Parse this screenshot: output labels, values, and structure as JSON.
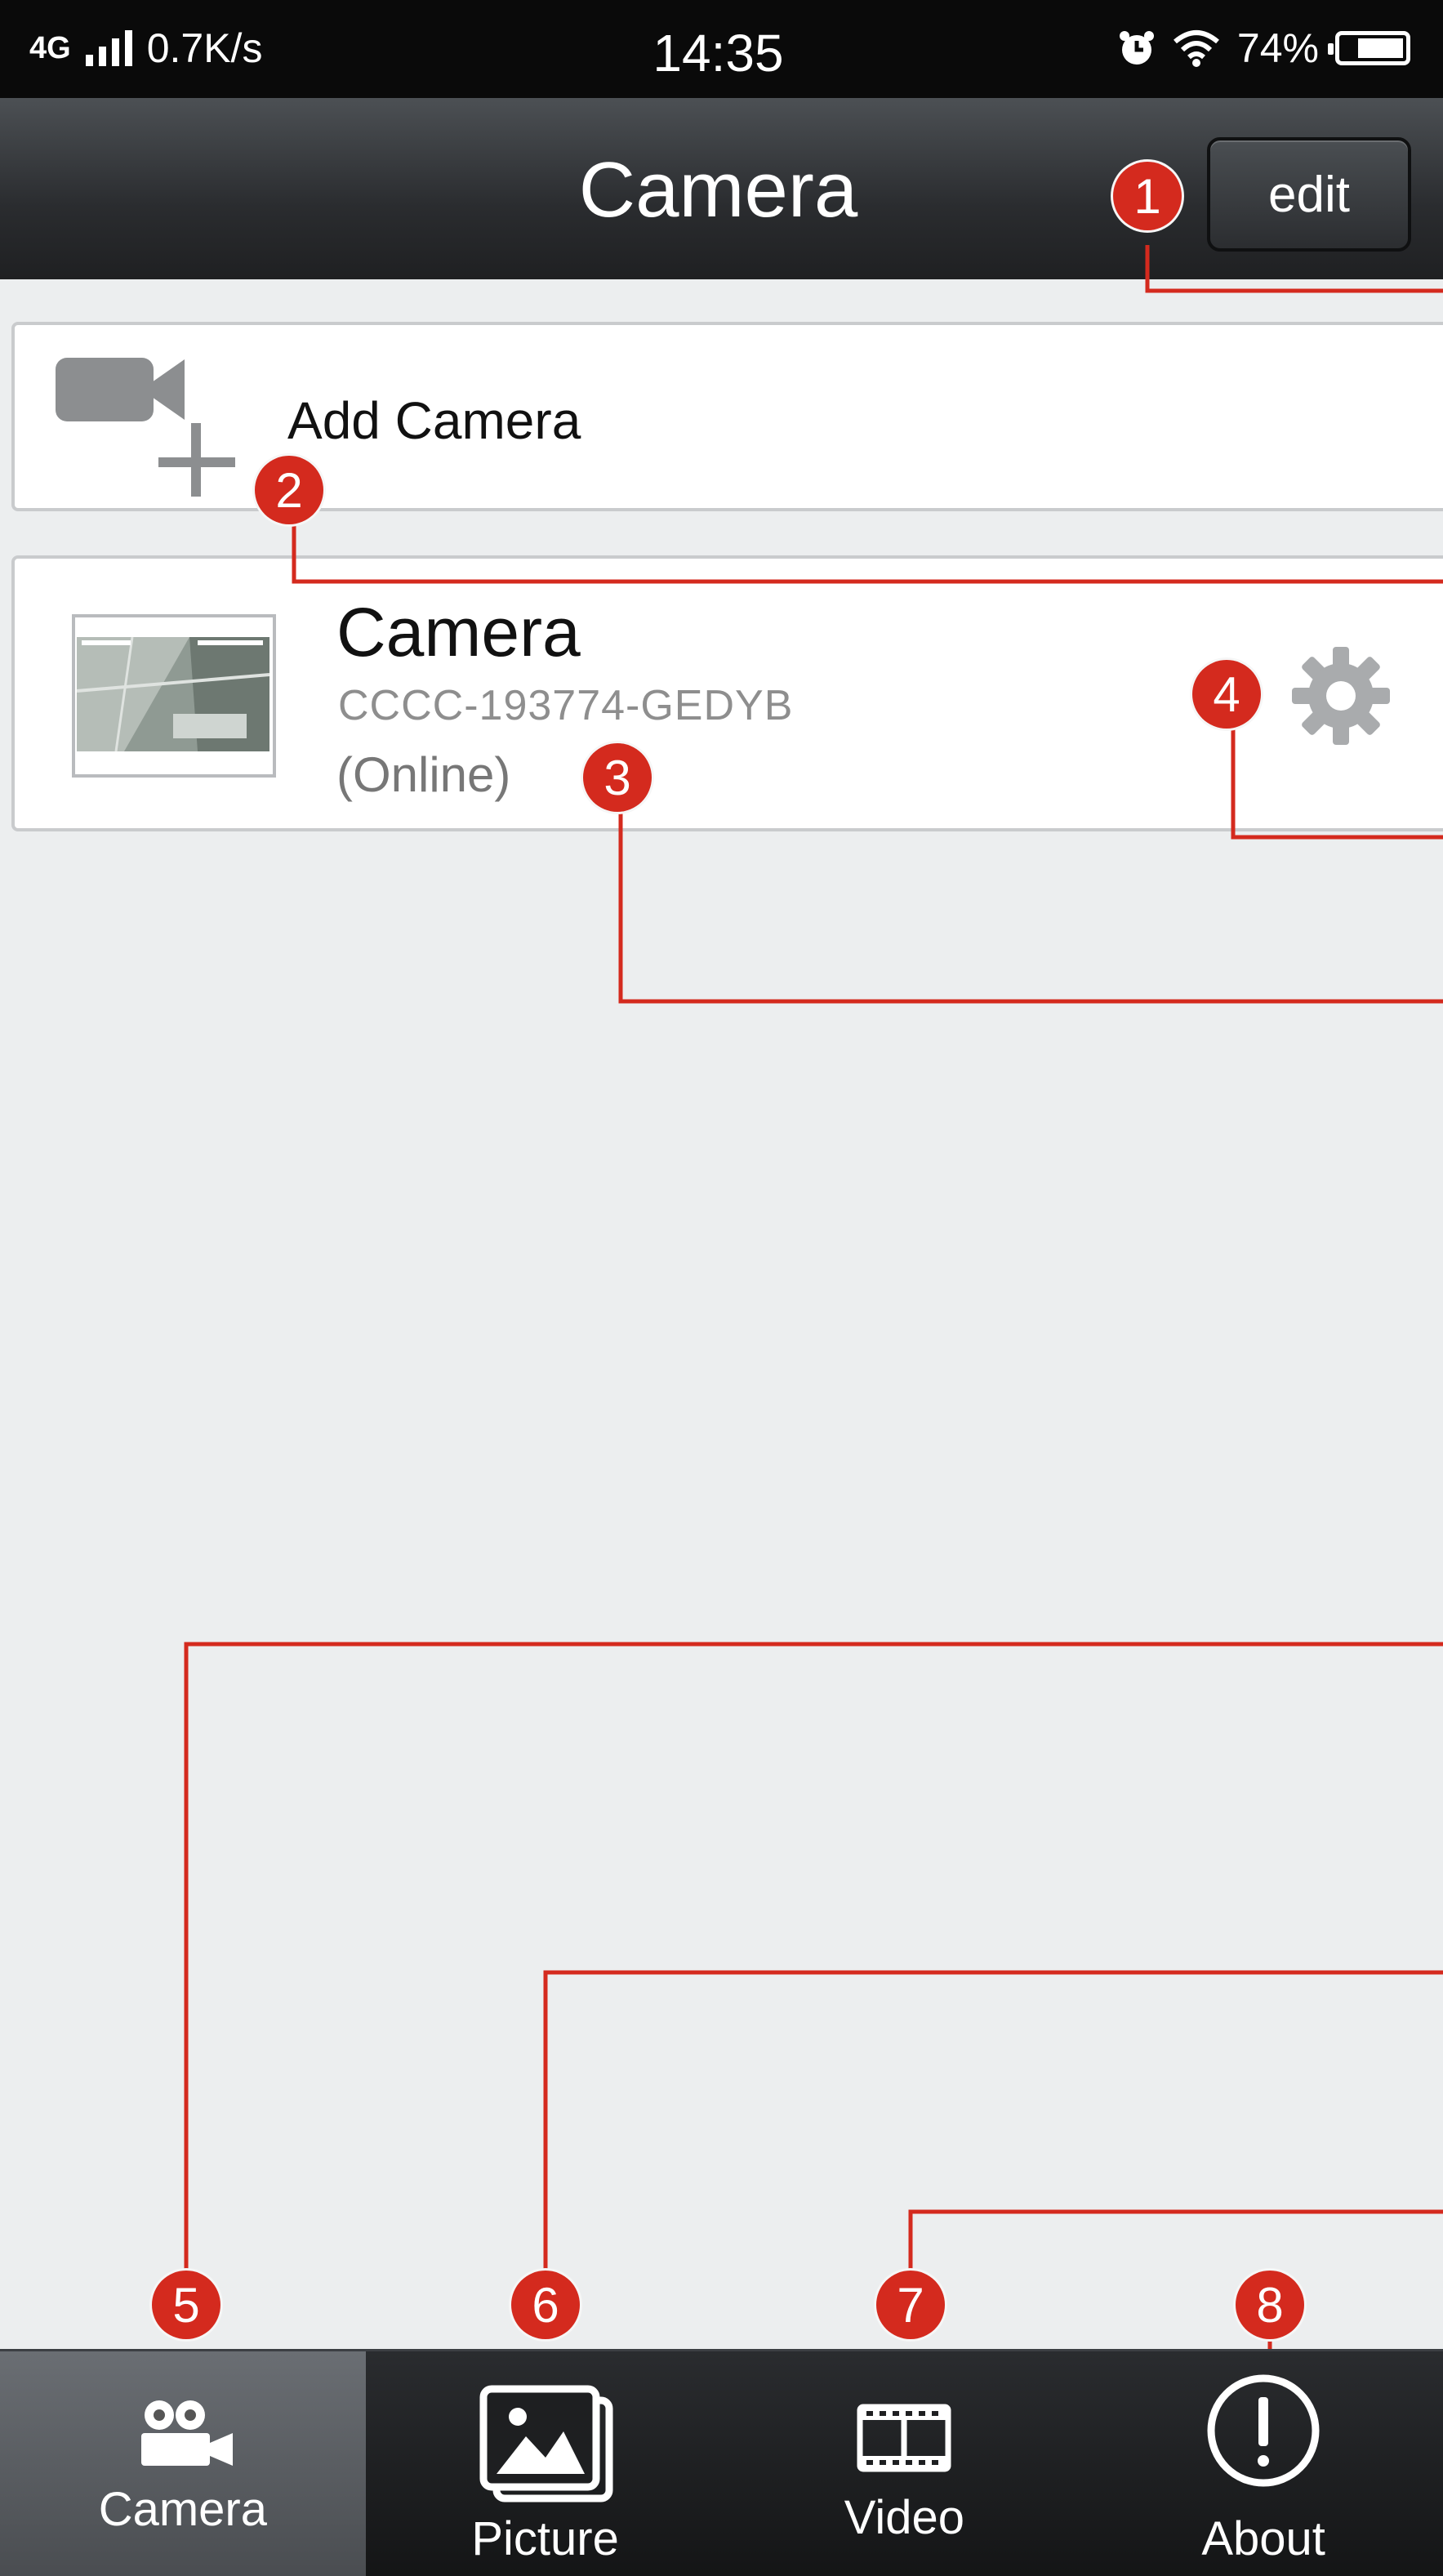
{
  "status_bar": {
    "network": "4G",
    "speed": "0.7K/s",
    "time": "14:35",
    "battery": "74%",
    "battery_level": 0.74,
    "icons": [
      "signal-icon",
      "alarm-icon",
      "wifi-icon",
      "battery-icon"
    ]
  },
  "nav": {
    "title": "Camera",
    "edit_label": "edit"
  },
  "add_camera": {
    "label": "Add Camera",
    "icon": "add-camera-icon"
  },
  "camera_item": {
    "name": "Camera",
    "id": "CCCC-193774-GEDYB",
    "status": "(Online)",
    "settings_icon": "gear-icon"
  },
  "markers": [
    "1",
    "2",
    "3",
    "4",
    "5",
    "6",
    "7",
    "8"
  ],
  "tabs": [
    {
      "label": "Camera",
      "icon": "camera-tab-icon",
      "active": true
    },
    {
      "label": "Picture",
      "icon": "picture-icon",
      "active": false
    },
    {
      "label": "Video",
      "icon": "video-film-icon",
      "active": false
    },
    {
      "label": "About",
      "icon": "info-icon",
      "active": false
    }
  ],
  "colors": {
    "annotation_red": "#d42a1e",
    "background": "#eceeef",
    "nav_dark": "#2a2c2f"
  }
}
